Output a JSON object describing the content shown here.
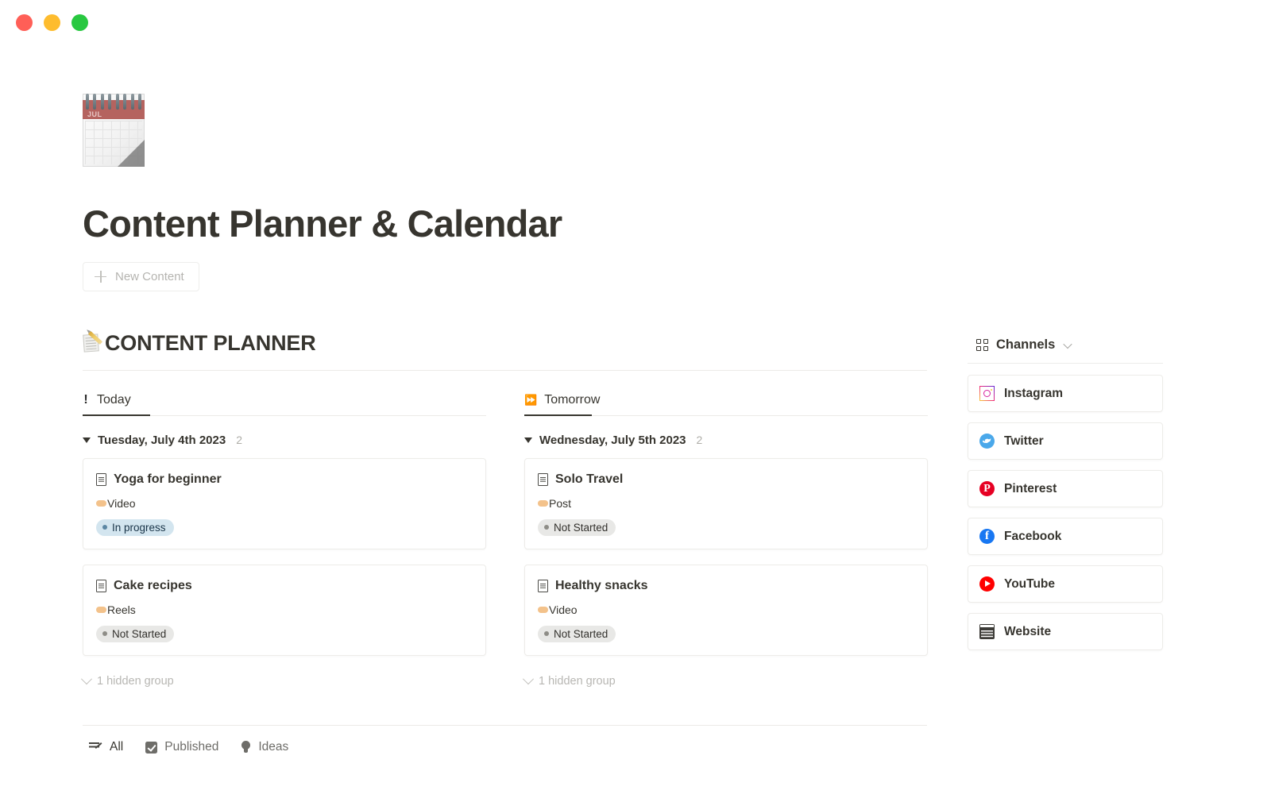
{
  "window": {
    "controls": [
      {
        "name": "close",
        "color": "#ff5f57"
      },
      {
        "name": "minimize",
        "color": "#febc2e"
      },
      {
        "name": "maximize",
        "color": "#28c840"
      }
    ]
  },
  "header": {
    "icon": "spiral-calendar-icon",
    "icon_month": "JUL",
    "title": "Content Planner & Calendar",
    "new_content_label": "New Content"
  },
  "section": {
    "icon": "memo-icon",
    "title": "CONTENT PLANNER"
  },
  "board": {
    "columns": [
      {
        "tab_icon": "exclamation-icon",
        "tab_label": "Today",
        "active": true,
        "group": {
          "label": "Tuesday, July 4th 2023",
          "count": "2"
        },
        "cards": [
          {
            "title": "Yoga for beginner",
            "tag": "Video",
            "tag_color": "#f3c28b",
            "status": "In progress",
            "status_style": "status-inprogress"
          },
          {
            "title": "Cake recipes",
            "tag": "Reels",
            "tag_color": "#f3c28b",
            "status": "Not Started",
            "status_style": "status-notstarted"
          }
        ],
        "hidden_group_label": "1 hidden group"
      },
      {
        "tab_icon": "next-track-icon",
        "tab_label": "Tomorrow",
        "active": true,
        "group": {
          "label": "Wednesday, July 5th 2023",
          "count": "2"
        },
        "cards": [
          {
            "title": "Solo Travel",
            "tag": "Post",
            "tag_color": "#f3c28b",
            "status": "Not Started",
            "status_style": "status-notstarted"
          },
          {
            "title": "Healthy snacks",
            "tag": "Video",
            "tag_color": "#f3c28b",
            "status": "Not Started",
            "status_style": "status-notstarted"
          }
        ],
        "hidden_group_label": "1 hidden group"
      }
    ]
  },
  "bottom_tabs": [
    {
      "icon": "list-edit-icon",
      "label": "All"
    },
    {
      "icon": "checkbox-checked-icon",
      "label": "Published"
    },
    {
      "icon": "lightbulb-icon",
      "label": "Ideas"
    }
  ],
  "sidebar": {
    "icon": "grid-icon",
    "title": "Channels",
    "chevron": "chevron-down-icon",
    "channels": [
      {
        "label": "Instagram",
        "icon": "instagram-icon",
        "color": "#d6249f"
      },
      {
        "label": "Twitter",
        "icon": "twitter-icon",
        "color": "#4aa8ea"
      },
      {
        "label": "Pinterest",
        "icon": "pinterest-icon",
        "color": "#e60023"
      },
      {
        "label": "Facebook",
        "icon": "facebook-icon",
        "color": "#1877f2"
      },
      {
        "label": "YouTube",
        "icon": "youtube-icon",
        "color": "#ff0000"
      },
      {
        "label": "Website",
        "icon": "website-icon",
        "color": "#3c3b37"
      }
    ]
  }
}
